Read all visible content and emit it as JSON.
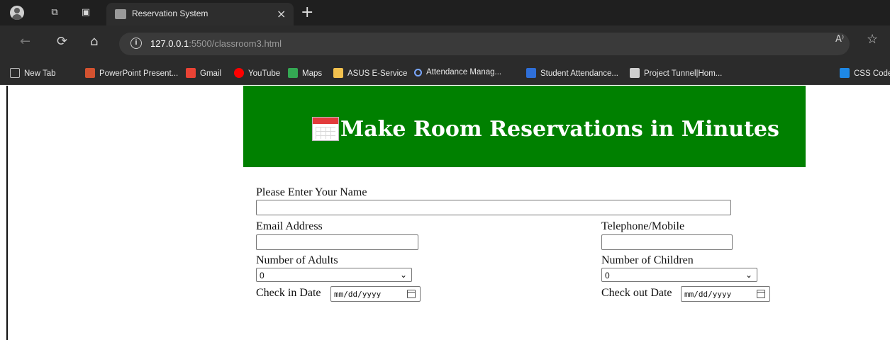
{
  "browser": {
    "tab": {
      "title": "Reservation System",
      "close_glyph": "×"
    },
    "new_tab_glyph": "+",
    "nav": {
      "back_glyph": "←",
      "reload_glyph": "⟳",
      "home_glyph": "⌂"
    },
    "url": {
      "host": "127.0.0.1",
      "rest": ":5500/classroom3.html"
    },
    "right_icons": {
      "read_aloud": "A⁾",
      "favorite": "☆"
    },
    "bookmarks": [
      {
        "label": "New Tab",
        "icon": "page-icon",
        "color": "#bdbdbd"
      },
      {
        "label": "PowerPoint Present...",
        "icon": "powerpoint-icon",
        "color": "#d35230"
      },
      {
        "label": "Gmail",
        "icon": "gmail-icon",
        "color": "#ea4335"
      },
      {
        "label": "YouTube",
        "icon": "youtube-icon",
        "color": "#ff0000"
      },
      {
        "label": "Maps",
        "icon": "maps-icon",
        "color": "#34a853"
      },
      {
        "label": "ASUS E-Service",
        "icon": "folder-icon",
        "color": "#f2c14e"
      },
      {
        "label": "Attendance Manag...",
        "icon": "search-icon",
        "color": "#7aa7ff"
      },
      {
        "label": "Student Attendance...",
        "icon": "blank-icon",
        "color": "#2f6fd8"
      },
      {
        "label": "Project Tunnel|Hom...",
        "icon": "project-icon",
        "color": "#cfcfcf"
      },
      {
        "label": "CSS Code",
        "icon": "css-icon",
        "color": "#1e88e5"
      }
    ]
  },
  "page": {
    "banner_title": "Make Room Reservations in Minutes",
    "banner_color": "#008000",
    "form": {
      "name_label": "Please Enter Your Name",
      "name_value": "",
      "email_label": "Email Address",
      "email_value": "",
      "phone_label": "Telephone/Mobile",
      "phone_value": "",
      "adults_label": "Number of Adults",
      "adults_value": "0",
      "children_label": "Number of Children",
      "children_value": "0",
      "checkin_label": "Check in Date",
      "checkin_placeholder": "mm/dd/yyyy",
      "checkout_label": "Check out Date",
      "checkout_placeholder": "mm/dd/yyyy"
    }
  }
}
